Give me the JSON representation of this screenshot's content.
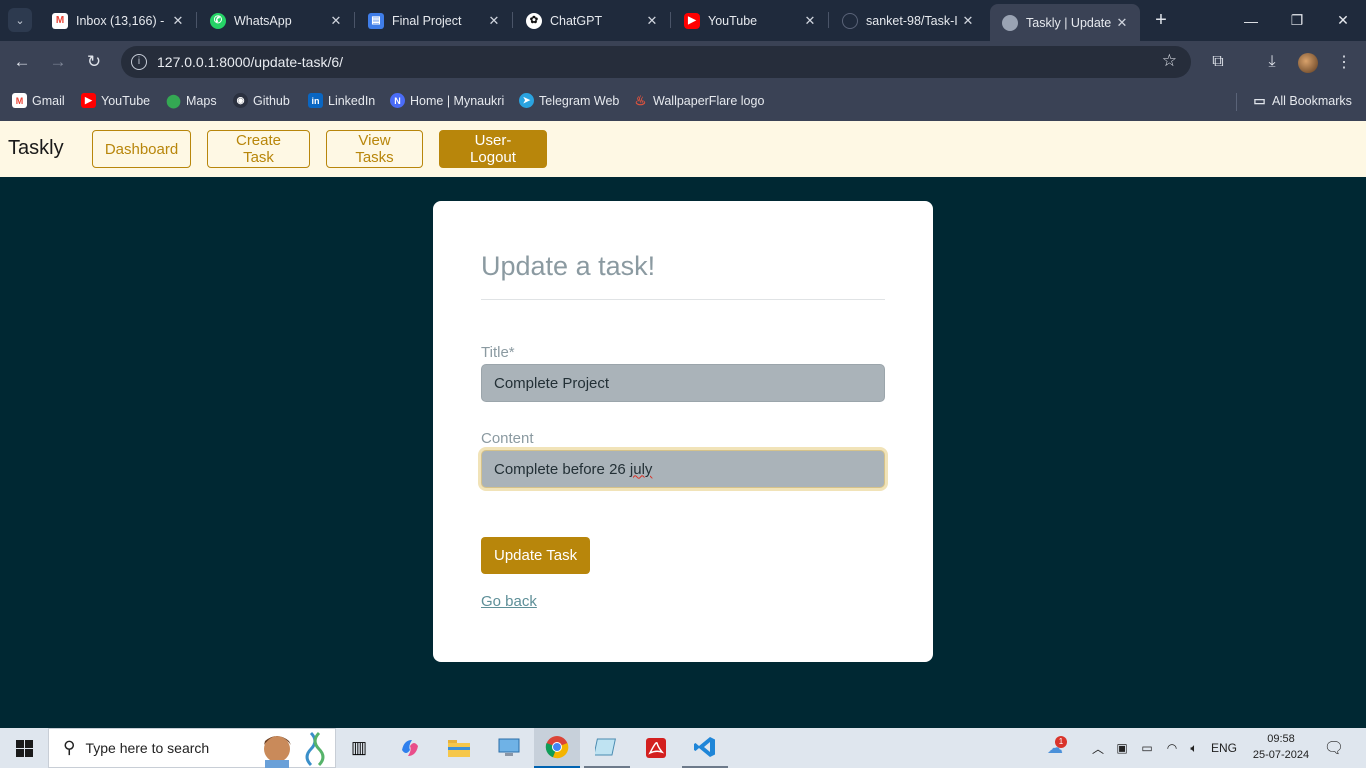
{
  "browser": {
    "tabs": [
      {
        "label": "Inbox (13,166) -",
        "icon": "gmail-icon",
        "color": "#ea4335"
      },
      {
        "label": "WhatsApp",
        "icon": "whatsapp-icon",
        "color": "#25d366"
      },
      {
        "label": "Final Project",
        "icon": "docs-icon",
        "color": "#3f7de8"
      },
      {
        "label": "ChatGPT",
        "icon": "chatgpt-icon",
        "color": "#ffffff"
      },
      {
        "label": "YouTube",
        "icon": "youtube-icon",
        "color": "#ff0000"
      },
      {
        "label": "sanket-98/Task-I",
        "icon": "github-icon",
        "color": "#1f2a3c"
      },
      {
        "label": "Taskly | Update T",
        "icon": "globe-icon",
        "color": "#9aa3b3",
        "active": true
      }
    ],
    "url": "127.0.0.1:8000/update-task/6/",
    "bookmarks": [
      {
        "label": "Gmail",
        "icon": "gmail-icon"
      },
      {
        "label": "YouTube",
        "icon": "youtube-icon"
      },
      {
        "label": "Maps",
        "icon": "maps-icon"
      },
      {
        "label": "Github",
        "icon": "github-icon"
      },
      {
        "label": "LinkedIn",
        "icon": "linkedin-icon"
      },
      {
        "label": "Home | Mynaukri",
        "icon": "naukri-icon"
      },
      {
        "label": "Telegram Web",
        "icon": "telegram-icon"
      },
      {
        "label": "WallpaperFlare logo",
        "icon": "flame-icon"
      }
    ],
    "all_bookmarks": "All Bookmarks"
  },
  "app": {
    "brand": "Taskly",
    "nav": {
      "dashboard": "Dashboard",
      "create_task": "Create Task",
      "view_tasks": "View Tasks",
      "logout": "User-Logout"
    },
    "accent": "#b8860b"
  },
  "form": {
    "heading": "Update a task!",
    "title_label": "Title*",
    "title_value": "Complete Project",
    "content_label": "Content",
    "content_value_prefix": "Complete before 26 ",
    "content_value_misspelled": "july",
    "submit_label": "Update Task",
    "go_back": "Go back"
  },
  "taskbar": {
    "search_placeholder": "Type here to search",
    "language": "ENG",
    "time": "09:58",
    "date": "25-07-2024",
    "notification_count": "1"
  }
}
